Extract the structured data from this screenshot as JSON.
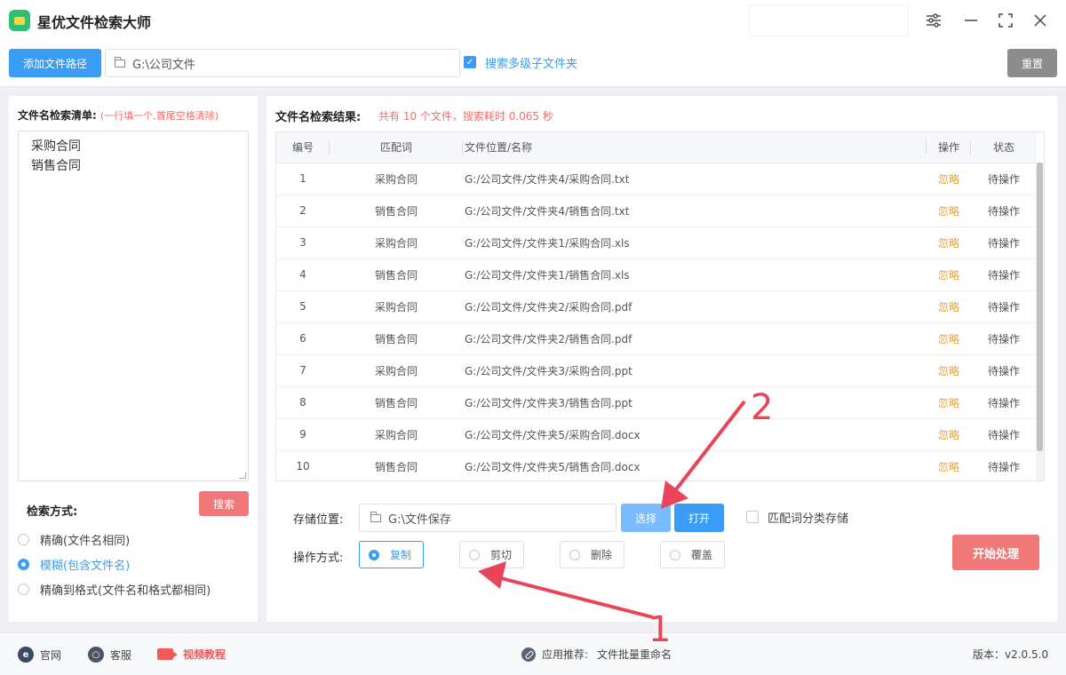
{
  "app": {
    "title": "星优文件检索大师",
    "brand_color": "#3b9cf5",
    "accent_red": "#f07878"
  },
  "pathbar": {
    "add_path_label": "添加文件路径",
    "path_value": "G:\\公司文件",
    "subfolder_checked": true,
    "subfolder_label": "搜索多级子文件夹",
    "reset_label": "重置"
  },
  "left": {
    "title": "文件名检索清单:",
    "hint": "(一行填一个,首尾空格清除)",
    "names": [
      "采购合同",
      "销售合同"
    ],
    "search_label": "搜索",
    "mode_label": "检索方式:",
    "modes": [
      {
        "label": "精确(文件名相同)",
        "selected": false
      },
      {
        "label": "模糊(包含文件名)",
        "selected": true
      },
      {
        "label": "精确到格式(文件名和格式都相同)",
        "selected": false
      }
    ]
  },
  "results": {
    "title": "文件名检索结果:",
    "summary": "共有 10 个文件，搜索耗时 0.065 秒",
    "columns": [
      "编号",
      "匹配词",
      "文件位置/名称",
      "操作",
      "状态"
    ],
    "rows": [
      {
        "no": "1",
        "word": "采购合同",
        "path": "G:/公司文件/文件夹4/采购合同.txt",
        "op": "忽略",
        "status": "待操作"
      },
      {
        "no": "2",
        "word": "销售合同",
        "path": "G:/公司文件/文件夹4/销售合同.txt",
        "op": "忽略",
        "status": "待操作"
      },
      {
        "no": "3",
        "word": "采购合同",
        "path": "G:/公司文件/文件夹1/采购合同.xls",
        "op": "忽略",
        "status": "待操作"
      },
      {
        "no": "4",
        "word": "销售合同",
        "path": "G:/公司文件/文件夹1/销售合同.xls",
        "op": "忽略",
        "status": "待操作"
      },
      {
        "no": "5",
        "word": "采购合同",
        "path": "G:/公司文件/文件夹2/采购合同.pdf",
        "op": "忽略",
        "status": "待操作"
      },
      {
        "no": "6",
        "word": "销售合同",
        "path": "G:/公司文件/文件夹2/销售合同.pdf",
        "op": "忽略",
        "status": "待操作"
      },
      {
        "no": "7",
        "word": "采购合同",
        "path": "G:/公司文件/文件夹3/采购合同.ppt",
        "op": "忽略",
        "status": "待操作"
      },
      {
        "no": "8",
        "word": "销售合同",
        "path": "G:/公司文件/文件夹3/销售合同.ppt",
        "op": "忽略",
        "status": "待操作"
      },
      {
        "no": "9",
        "word": "采购合同",
        "path": "G:/公司文件/文件夹5/采购合同.docx",
        "op": "忽略",
        "status": "待操作"
      },
      {
        "no": "10",
        "word": "销售合同",
        "path": "G:/公司文件/文件夹5/销售合同.docx",
        "op": "忽略",
        "status": "待操作"
      }
    ]
  },
  "storage": {
    "label": "存储位置:",
    "path_value": "G:\\文件保存",
    "choose_label": "选择",
    "open_label": "打开",
    "classify_checked": false,
    "classify_label": "匹配词分类存储"
  },
  "operation": {
    "label": "操作方式:",
    "options": [
      {
        "label": "复制",
        "selected": true
      },
      {
        "label": "剪切",
        "selected": false
      },
      {
        "label": "删除",
        "selected": false
      },
      {
        "label": "覆盖",
        "selected": false
      }
    ],
    "start_label": "开始处理"
  },
  "statusbar": {
    "site_label": "官网",
    "service_label": "客服",
    "video_label": "视频教程",
    "recommend_prefix": "应用推荐:",
    "recommend_app": "文件批量重命名",
    "version": "版本：v2.0.5.0"
  },
  "annotations": {
    "color": "#e8445a",
    "labels": [
      "1",
      "2"
    ]
  }
}
